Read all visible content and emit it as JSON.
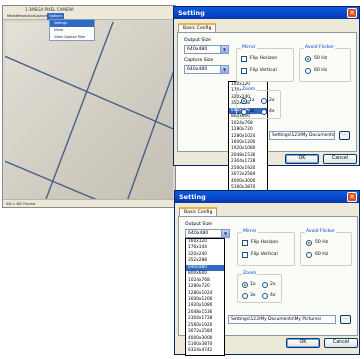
{
  "camera": {
    "title": "1.3MEGA PIXEL CAMERA",
    "menus": [
      "Media",
      "Resolution",
      "Capture",
      "Options"
    ],
    "options_items": [
      "Settings",
      "Mirror",
      "Video Capture Filter"
    ],
    "status": "640 x 480 Preview"
  },
  "dialog": {
    "title": "Setting",
    "tab": "Basic Config",
    "output_size_label": "Output Size",
    "output_size_value": "640x480",
    "capture_size_label": "Capture Size",
    "capture_size_value": "640x480",
    "mirror_label": "Mirror",
    "flip_horizon": "Flip Horizon",
    "flip_vertical": "Flip Vertical",
    "flicker_label": "Avoid Flicker",
    "hz50": "50 Hz",
    "hz60": "60 Hz",
    "zoom_label": "Zoom",
    "zoom": [
      "1x",
      "2x",
      "3x",
      "4x"
    ],
    "path": "Settings\\123\\My Documents\\My Pictures\\",
    "browse": "...",
    "ok": "OK",
    "cancel": "Cancel"
  },
  "resolutions": [
    "160x120",
    "176x144",
    "320x240",
    "352x288",
    "640x480",
    "800x600",
    "1024x768",
    "1280x720",
    "1280x1024",
    "1600x1200",
    "1920x1080",
    "2048x1536",
    "2304x1728",
    "2560x1920",
    "3072x2584",
    "4000x3000",
    "5160x3870",
    "6324x4742"
  ],
  "selected_resolution": "640x480",
  "colors": {
    "title_bar": "#0846c6",
    "selection": "#316ac5",
    "close_button": "#e04a24",
    "dialog_bg": "#ece9d8"
  }
}
